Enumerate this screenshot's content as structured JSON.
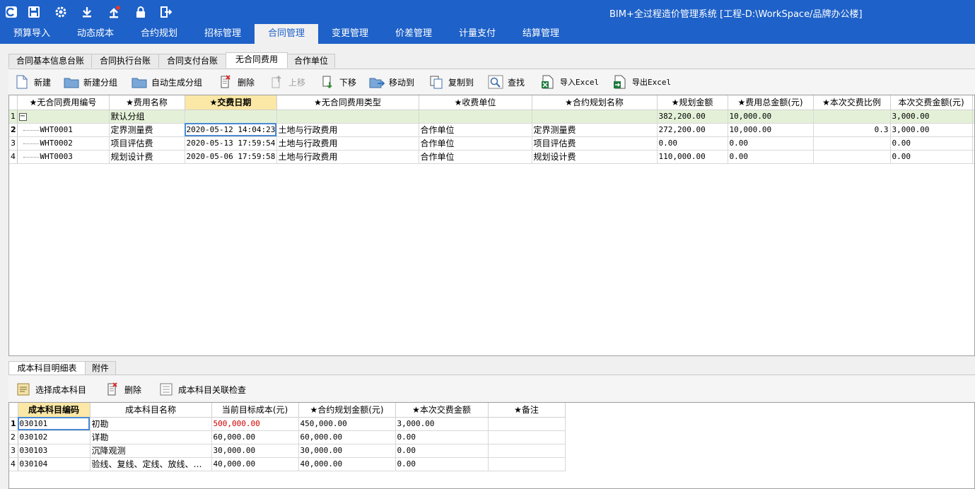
{
  "app": {
    "title": "BIM+全过程造价管理系统 [工程-D:\\WorkSpace/品牌办公楼]",
    "quick_access": [
      "app-logo-icon",
      "save-icon",
      "settings-gear-icon",
      "download-icon",
      "upload-icon",
      "lock-icon",
      "exit-icon"
    ]
  },
  "menu": [
    "预算导入",
    "动态成本",
    "合约规划",
    "招标管理",
    "合同管理",
    "变更管理",
    "价差管理",
    "计量支付",
    "结算管理"
  ],
  "menu_active": "合同管理",
  "subtabs": [
    "合同基本信息台账",
    "合同执行台账",
    "合同支付台账",
    "无合同费用",
    "合作单位"
  ],
  "subtab_active": "无合同费用",
  "toolbar": {
    "new": "新建",
    "new_group": "新建分组",
    "auto_group": "自动生成分组",
    "delete": "删除",
    "move_up": "上移",
    "move_down": "下移",
    "move_to": "移动到",
    "copy_to": "复制到",
    "find": "查找",
    "import_excel": "导入Excel",
    "export_excel": "导出Excel"
  },
  "main_table": {
    "columns": [
      "★无合同费用编号",
      "★费用名称",
      "★交费日期",
      "★无合同费用类型",
      "★收费单位",
      "★合约规划名称",
      "★规划金额",
      "★费用总金额(元)",
      "★本次交费比例",
      "本次交费金额(元)"
    ],
    "group_row": {
      "row_no": "1",
      "toggle": "−",
      "name": "默认分组",
      "plan_amount": "382,200.00",
      "total": "10,000.00",
      "this_amount": "3,000.00"
    },
    "rows": [
      {
        "row_no": "2",
        "code": "WHT0001",
        "name": "定界测量费",
        "date": "2020-05-12 14:04:23",
        "type": "土地与行政费用",
        "unit": "合作单位",
        "plan_name": "定界测量费",
        "plan_amount": "272,200.00",
        "total": "10,000.00",
        "ratio": "0.3",
        "this_amount": "3,000.00"
      },
      {
        "row_no": "3",
        "code": "WHT0002",
        "name": "项目评估费",
        "date": "2020-05-13 17:59:54",
        "type": "土地与行政费用",
        "unit": "合作单位",
        "plan_name": "项目评估费",
        "plan_amount": "0.00",
        "total": "0.00",
        "ratio": "",
        "this_amount": "0.00"
      },
      {
        "row_no": "4",
        "code": "WHT0003",
        "name": "规划设计费",
        "date": "2020-05-06 17:59:58",
        "type": "土地与行政费用",
        "unit": "合作单位",
        "plan_name": "规划设计费",
        "plan_amount": "110,000.00",
        "total": "0.00",
        "ratio": "",
        "this_amount": "0.00"
      }
    ]
  },
  "bottom_tabs": [
    "成本科目明细表",
    "附件"
  ],
  "bottom_tab_active": "成本科目明细表",
  "bottom_toolbar": {
    "select_subject": "选择成本科目",
    "delete": "删除",
    "check": "成本科目关联检查"
  },
  "detail_table": {
    "columns": [
      "成本科目编码",
      "成本科目名称",
      "当前目标成本(元)",
      "★合约规划金额(元)",
      "★本次交费金额",
      "★备注"
    ],
    "rows": [
      {
        "row_no": "1",
        "code": "030101",
        "name": "初勘",
        "target": "500,000.00",
        "plan": "450,000.00",
        "this": "3,000.00",
        "note": ""
      },
      {
        "row_no": "2",
        "code": "030102",
        "name": "详勘",
        "target": "60,000.00",
        "plan": "60,000.00",
        "this": "0.00",
        "note": ""
      },
      {
        "row_no": "3",
        "code": "030103",
        "name": "沉降观测",
        "target": "30,000.00",
        "plan": "30,000.00",
        "this": "0.00",
        "note": ""
      },
      {
        "row_no": "4",
        "code": "030104",
        "name": "验线、复线、定线、放线、…",
        "target": "40,000.00",
        "plan": "40,000.00",
        "this": "0.00",
        "note": ""
      }
    ]
  },
  "colors": {
    "brand": "#1e61c8",
    "group_row": "#e4f1d8",
    "sorted_header": "#fbe8a6",
    "over_budget": "#d00000"
  }
}
